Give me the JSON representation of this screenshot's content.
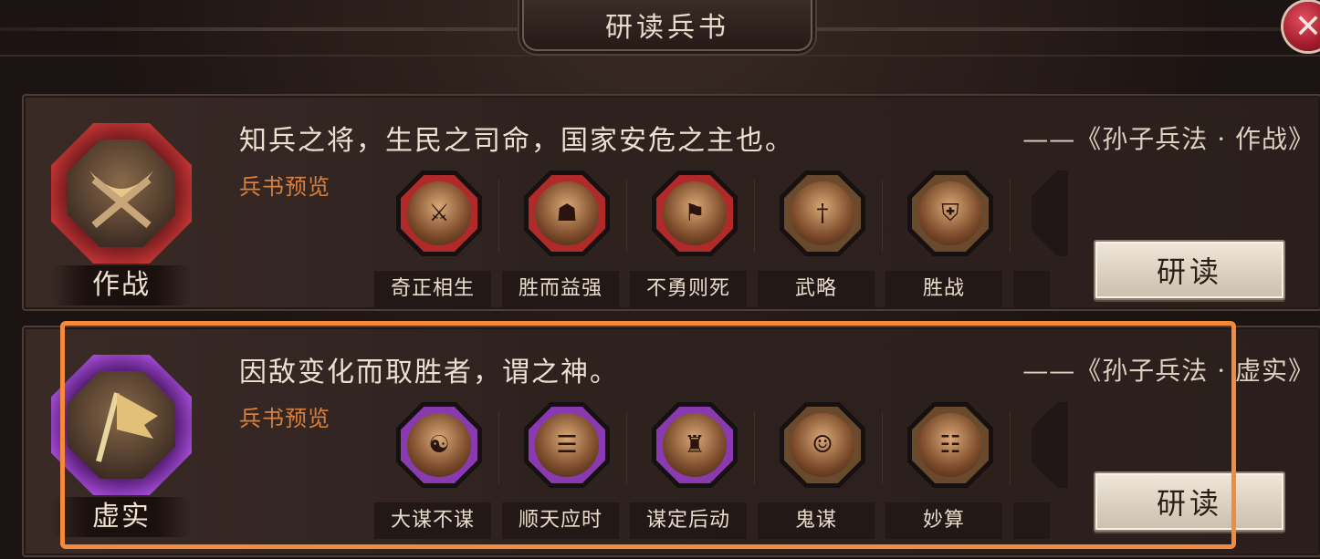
{
  "header": {
    "title": "研读兵书",
    "close_icon": "✕"
  },
  "cards": [
    {
      "emblem_label": "作战",
      "emblem_icon": "crossed-swords-helmet",
      "quote": "知兵之将，生民之司命，国家安危之主也。",
      "source": "——《孙子兵法 · 作战》",
      "preview_label": "兵书预览",
      "skills": [
        "奇正相生",
        "胜而益强",
        "不勇则死",
        "武略",
        "胜战"
      ],
      "button_label": "研读"
    },
    {
      "emblem_label": "虚实",
      "emblem_icon": "war-banner",
      "quote": "因敌变化而取胜者，谓之神。",
      "source": "——《孙子兵法 · 虚实》",
      "preview_label": "兵书预览",
      "skills": [
        "大谋不谋",
        "顺天应时",
        "谋定后动",
        "鬼谋",
        "妙算"
      ],
      "button_label": "研读"
    }
  ],
  "colors": {
    "accent_orange": "#f58a3c",
    "preview_label": "#d8803e",
    "emblem_red": "#c23434",
    "emblem_purple": "#a04ad0"
  }
}
